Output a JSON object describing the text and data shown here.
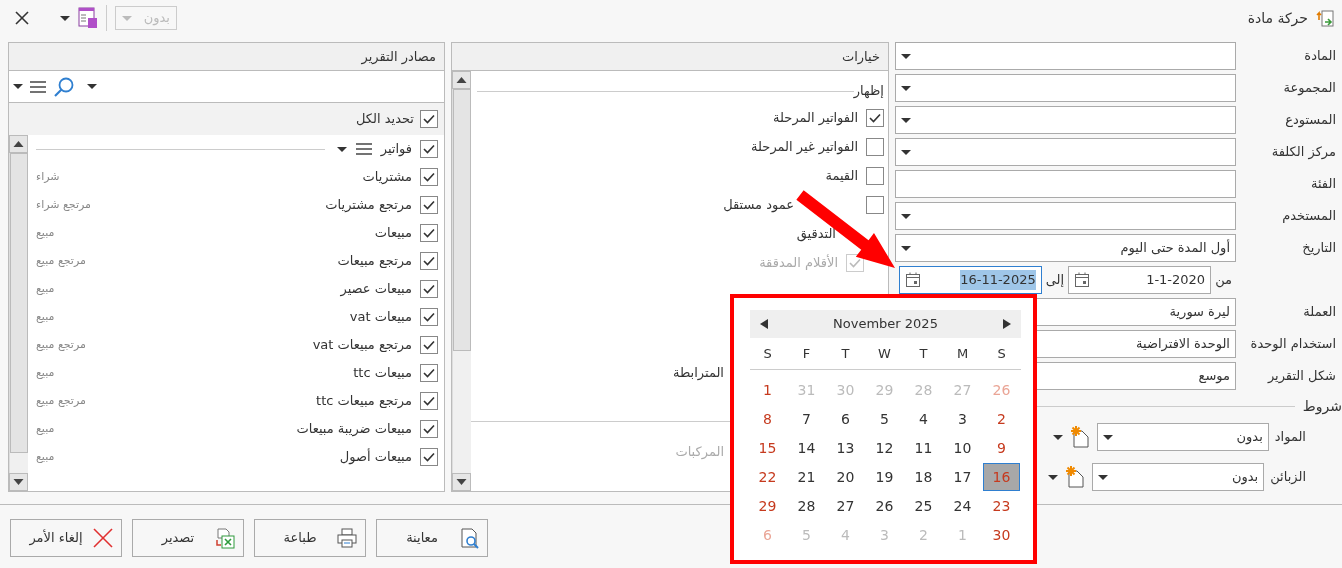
{
  "window": {
    "title": "حركة مادة"
  },
  "toolbar": {
    "filter": {
      "value": "بدون",
      "disabled": true
    }
  },
  "form": {
    "fields": [
      {
        "kind": "combo",
        "label": "المادة"
      },
      {
        "kind": "combo",
        "label": "المجموعة"
      },
      {
        "kind": "combo",
        "label": "المستودع"
      },
      {
        "kind": "combo",
        "label": "مركز الكلفة"
      },
      {
        "kind": "text",
        "label": "الفئة"
      },
      {
        "kind": "combo",
        "label": "المستخدم"
      },
      {
        "kind": "combo",
        "label": "التاريخ",
        "value": "أول المدة حتى اليوم"
      },
      {
        "kind": "daterange",
        "from_label": "من",
        "from": "1-1-2020",
        "to_label": "إلى",
        "to": "16-11-2025",
        "to_focused": true
      },
      {
        "kind": "text",
        "label": "العملة",
        "value": "ليرة سورية"
      },
      {
        "kind": "text",
        "label": "استخدام الوحدة",
        "value": "الوحدة الافتراضية"
      },
      {
        "kind": "text",
        "label": "شكل التقرير",
        "value": "موسع"
      }
    ]
  },
  "conditions": {
    "title": "شروط",
    "rows": [
      {
        "label": "المواد",
        "value": "بدون"
      },
      {
        "label": "الزبائن",
        "value": "بدون"
      }
    ]
  },
  "options": {
    "title": "خيارات",
    "items": [
      {
        "kind": "heading",
        "label": "إظهار"
      },
      {
        "kind": "check",
        "label": "الفواتير المرحلة",
        "checked": true,
        "disabled": false
      },
      {
        "kind": "check",
        "label": "الفواتير غير المرحلة",
        "checked": false,
        "disabled": false
      },
      {
        "kind": "check",
        "label": "القيمة",
        "checked": false,
        "disabled": false
      },
      {
        "kind": "check",
        "label": "عمود مستقل",
        "checked": false,
        "disabled": false,
        "covered": true
      },
      {
        "kind": "covered_check",
        "label": "التدقيق",
        "children": [
          {
            "kind": "check",
            "label": "الأقلام المدققة",
            "checked": true,
            "disabled": true
          }
        ]
      },
      {
        "kind": "label",
        "label": "المترابطة",
        "disabled": false
      },
      {
        "kind": "section_label",
        "label": "المركبات",
        "disabled": true
      }
    ]
  },
  "sources": {
    "title": "مصادر التقرير",
    "select_all": {
      "label": "تحديد الكل",
      "checked": true
    },
    "group": {
      "label": "فواتير",
      "checked": true
    },
    "items": [
      {
        "name": "مشتريات",
        "type": "شراء",
        "checked": true
      },
      {
        "name": "مرتجع مشتريات",
        "type": "مرتجع شراء",
        "checked": true
      },
      {
        "name": "مبيعات",
        "type": "مبيع",
        "checked": true
      },
      {
        "name": "مرتجع مبيعات",
        "type": "مرتجع مبيع",
        "checked": true
      },
      {
        "name": "مبيعات عصير",
        "type": "مبيع",
        "checked": true
      },
      {
        "name": "مبيعات vat",
        "type": "مبيع",
        "checked": true
      },
      {
        "name": "مرتجع مبيعات vat",
        "type": "مرتجع مبيع",
        "checked": true
      },
      {
        "name": "مبيعات ttc",
        "type": "مبيع",
        "checked": true
      },
      {
        "name": "مرتجع مبيعات ttc",
        "type": "مرتجع مبيع",
        "checked": true
      },
      {
        "name": "مبيعات ضريبة مبيعات",
        "type": "مبيع",
        "checked": true
      },
      {
        "name": "مبيعات أصول",
        "type": "مبيع",
        "checked": true
      }
    ]
  },
  "buttons": [
    {
      "label": "معاينة",
      "kind": "preview"
    },
    {
      "label": "طباعة",
      "kind": "print"
    },
    {
      "label": "تصدير",
      "kind": "export"
    },
    {
      "label": "إلغاء الأمر",
      "kind": "cancel"
    }
  ],
  "calendar": {
    "month": "November 2025",
    "weekdays": [
      {
        "label": "S",
        "weekend": true
      },
      {
        "label": "M",
        "weekend": false
      },
      {
        "label": "T",
        "weekend": false
      },
      {
        "label": "W",
        "weekend": false
      },
      {
        "label": "T",
        "weekend": false
      },
      {
        "label": "F",
        "weekend": false
      },
      {
        "label": "S",
        "weekend": true
      }
    ],
    "weeks": [
      [
        {
          "day": "26",
          "muted": true,
          "selected": false
        },
        {
          "day": "27",
          "muted": true,
          "selected": false
        },
        {
          "day": "28",
          "muted": true,
          "selected": false
        },
        {
          "day": "29",
          "muted": true,
          "selected": false
        },
        {
          "day": "30",
          "muted": true,
          "selected": false
        },
        {
          "day": "31",
          "muted": true,
          "selected": false
        },
        {
          "day": "1",
          "muted": false,
          "selected": false
        }
      ],
      [
        {
          "day": "2",
          "muted": false,
          "selected": false
        },
        {
          "day": "3",
          "muted": false,
          "selected": false
        },
        {
          "day": "4",
          "muted": false,
          "selected": false
        },
        {
          "day": "5",
          "muted": false,
          "selected": false
        },
        {
          "day": "6",
          "muted": false,
          "selected": false
        },
        {
          "day": "7",
          "muted": false,
          "selected": false
        },
        {
          "day": "8",
          "muted": false,
          "selected": false
        }
      ],
      [
        {
          "day": "9",
          "muted": false,
          "selected": false
        },
        {
          "day": "10",
          "muted": false,
          "selected": false
        },
        {
          "day": "11",
          "muted": false,
          "selected": false
        },
        {
          "day": "12",
          "muted": false,
          "selected": false
        },
        {
          "day": "13",
          "muted": false,
          "selected": false
        },
        {
          "day": "14",
          "muted": false,
          "selected": false
        },
        {
          "day": "15",
          "muted": false,
          "selected": false
        }
      ],
      [
        {
          "day": "16",
          "muted": false,
          "selected": true
        },
        {
          "day": "17",
          "muted": false,
          "selected": false
        },
        {
          "day": "18",
          "muted": false,
          "selected": false
        },
        {
          "day": "19",
          "muted": false,
          "selected": false
        },
        {
          "day": "20",
          "muted": false,
          "selected": false
        },
        {
          "day": "21",
          "muted": false,
          "selected": false
        },
        {
          "day": "22",
          "muted": false,
          "selected": false
        }
      ],
      [
        {
          "day": "23",
          "muted": false,
          "selected": false
        },
        {
          "day": "24",
          "muted": false,
          "selected": false
        },
        {
          "day": "25",
          "muted": false,
          "selected": false
        },
        {
          "day": "26",
          "muted": false,
          "selected": false
        },
        {
          "day": "27",
          "muted": false,
          "selected": false
        },
        {
          "day": "28",
          "muted": false,
          "selected": false
        },
        {
          "day": "29",
          "muted": false,
          "selected": false
        }
      ],
      [
        {
          "day": "30",
          "muted": false,
          "selected": false
        },
        {
          "day": "1",
          "muted": true,
          "selected": false
        },
        {
          "day": "2",
          "muted": true,
          "selected": false
        },
        {
          "day": "3",
          "muted": true,
          "selected": false
        },
        {
          "day": "4",
          "muted": true,
          "selected": false
        },
        {
          "day": "5",
          "muted": true,
          "selected": false
        },
        {
          "day": "6",
          "muted": true,
          "selected": false
        }
      ]
    ]
  }
}
